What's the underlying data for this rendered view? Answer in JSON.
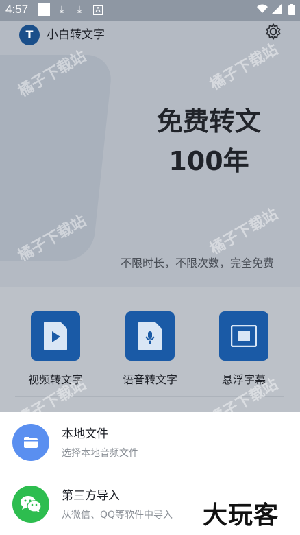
{
  "status_bar": {
    "time": "4:57",
    "icons": [
      "square-icon",
      "download-icon",
      "download-icon",
      "a-icon",
      "wifi-icon",
      "signal-icon",
      "battery-icon"
    ]
  },
  "header": {
    "app_name": "小白转文字",
    "logo_letter": "T"
  },
  "hero": {
    "headline_line1": "免费转文",
    "headline_line2": "100年",
    "subtitle": "不限时长，不限次数，完全免费"
  },
  "features": [
    {
      "label": "视频转文字",
      "icon": "video-file-icon"
    },
    {
      "label": "语音转文字",
      "icon": "mic-file-icon"
    },
    {
      "label": "悬浮字幕",
      "icon": "floating-window-icon"
    }
  ],
  "watermark": "橘子下载站",
  "sheet": {
    "items": [
      {
        "title": "本地文件",
        "subtitle": "选择本地音频文件",
        "color": "#5a8ff0",
        "icon": "folder-icon"
      },
      {
        "title": "第三方导入",
        "subtitle": "从微信、QQ等软件中导入",
        "color": "#2dbd4f",
        "icon": "wechat-icon"
      }
    ]
  },
  "corner_logo": "大玩客",
  "colors": {
    "brand": "#1a5aa6"
  }
}
